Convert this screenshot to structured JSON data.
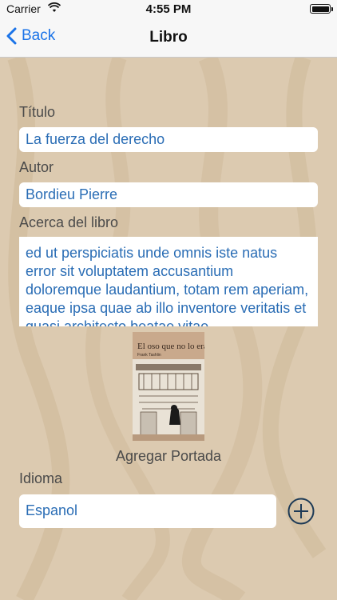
{
  "status_bar": {
    "carrier": "Carrier",
    "time": "4:55 PM"
  },
  "nav": {
    "back_label": "Back",
    "title": "Libro"
  },
  "form": {
    "title_label": "Título",
    "title_value": "La fuerza del derecho",
    "author_label": "Autor",
    "author_value": "Bordieu Pierre",
    "about_label": "Acerca del libro",
    "about_value": "ed ut perspiciatis unde omnis iste natus error sit voluptatem accusantium doloremque laudantium, totam rem aperiam, eaque ipsa quae ab illo inventore veritatis et quasi architecto beatae vitae",
    "cover_title": "El oso que no lo era",
    "cover_author": "Frank Tashlin",
    "add_cover_label": "Agregar Portada",
    "language_label": "Idioma",
    "language_value": "Espanol"
  },
  "colors": {
    "background": "#dccab0",
    "accent": "#1a73e8",
    "field_text": "#2a6db5"
  }
}
